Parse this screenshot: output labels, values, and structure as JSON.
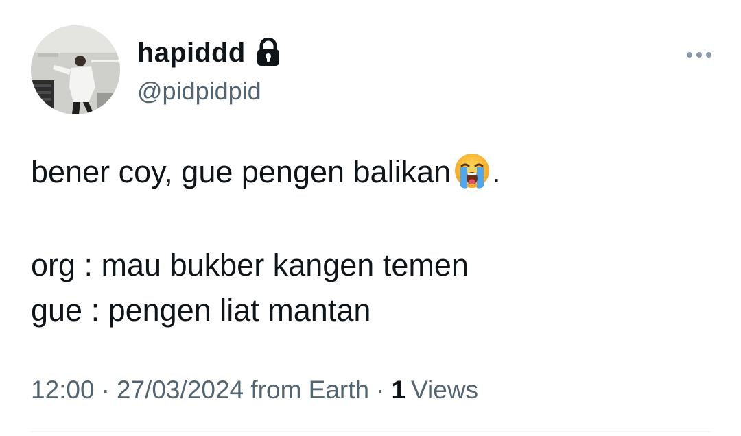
{
  "user": {
    "display_name": "hapiddd",
    "handle": "@pidpidpid",
    "protected_icon": "lock-icon",
    "avatar_icon": "profile-photo"
  },
  "more_icon": "more-horizontal-icon",
  "tweet": {
    "line1": "bener coy, gue pengen balikan",
    "line1_emoji": "loudly-crying-face-emoji",
    "line1_end": ".",
    "line2": "org : mau bukber kangen temen",
    "line3": "gue : pengen liat mantan"
  },
  "meta": {
    "time": "12:00",
    "separator": "·",
    "date": "27/03/2024",
    "source": "from Earth",
    "views_count": "1",
    "views_label": "Views"
  },
  "colors": {
    "text_primary": "#0f1419",
    "text_secondary": "#536471",
    "divider": "#eff3f4"
  }
}
